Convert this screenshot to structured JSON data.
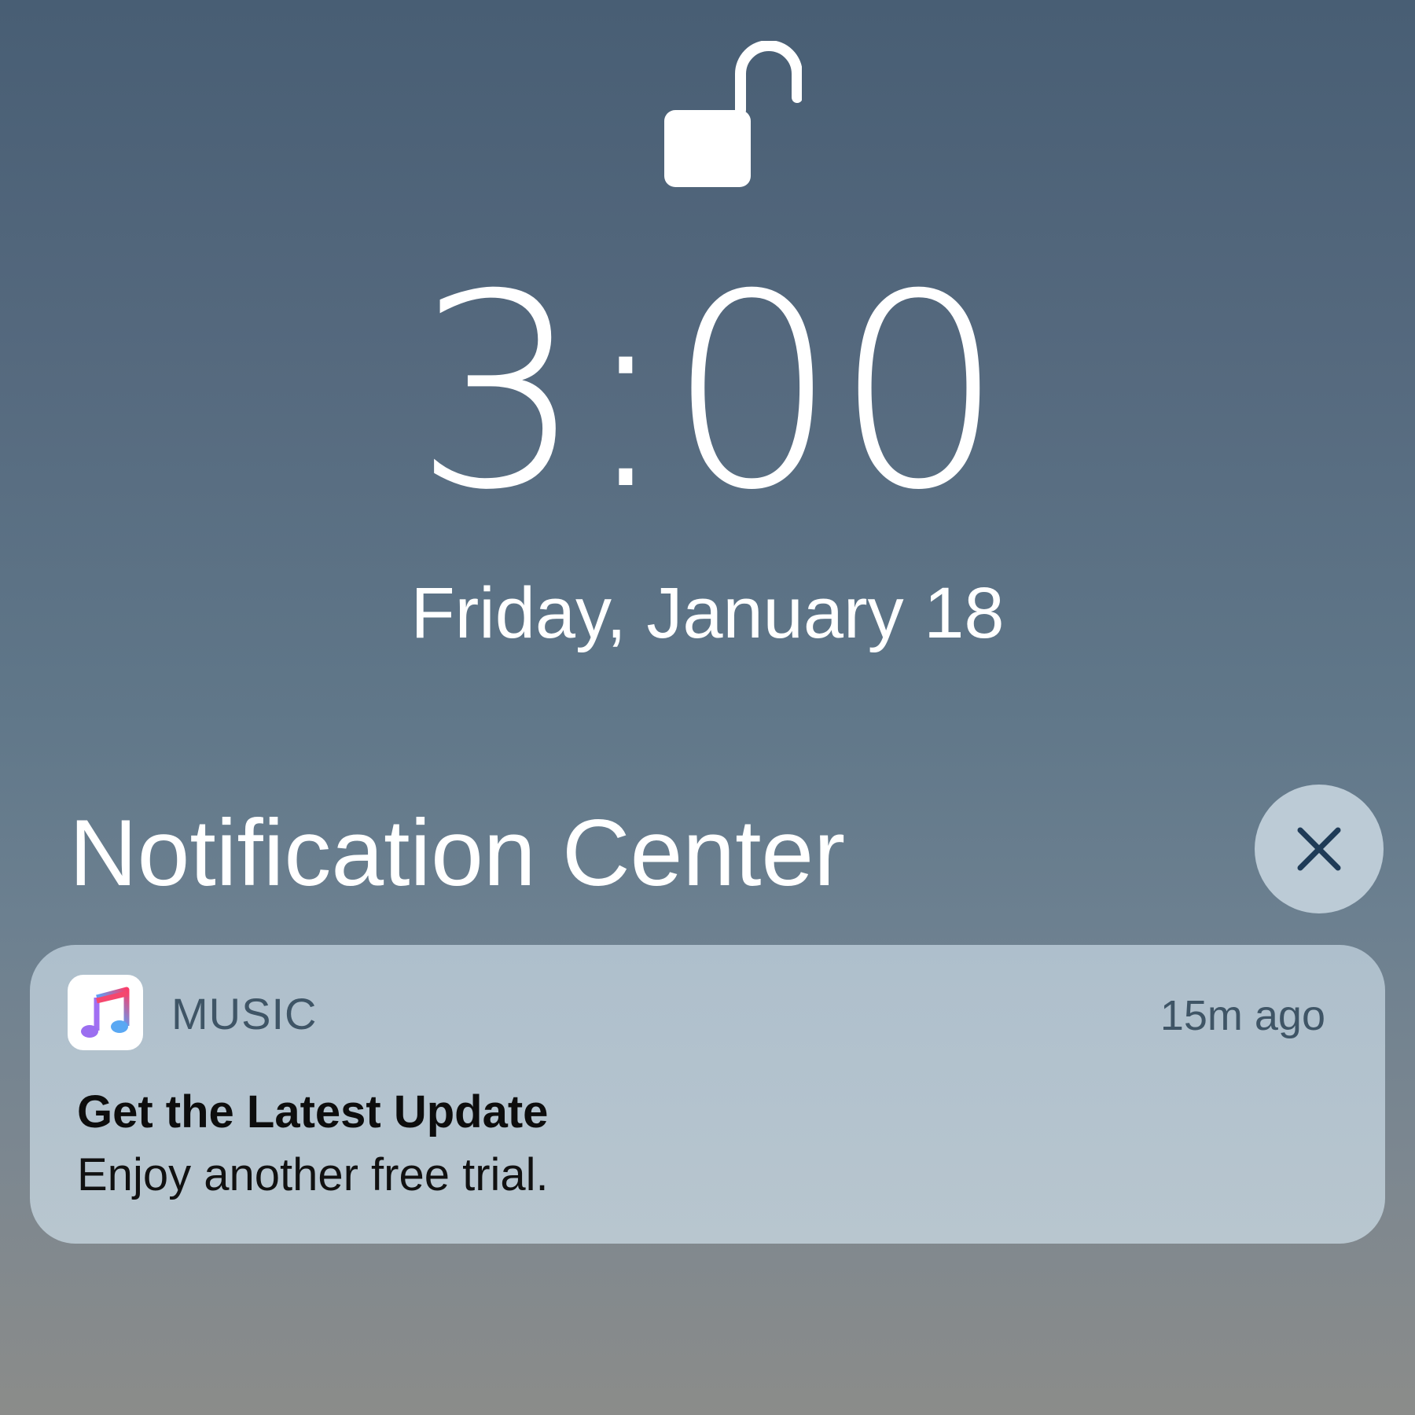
{
  "lock_screen": {
    "lock_state_icon": "unlocked-padlock-icon",
    "time": "3:00",
    "date": "Friday, January 18"
  },
  "notification_center": {
    "title": "Notification Center",
    "close_icon": "close-icon"
  },
  "notification": {
    "app_icon": "music-note-icon",
    "app_name": "MUSIC",
    "timestamp": "15m ago",
    "title": "Get the Latest Update",
    "body": "Enjoy another free trial."
  },
  "colors": {
    "close_button_bg": "#bccbd6",
    "close_glyph": "#1f3b57",
    "card_bg": "#b3c3ce",
    "secondary_text": "#3f5566"
  }
}
